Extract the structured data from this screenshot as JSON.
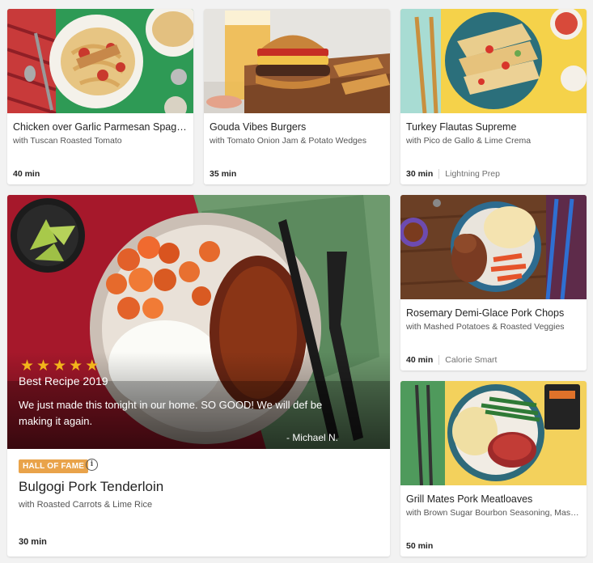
{
  "recipes": [
    {
      "title": "Chicken over Garlic Parmesan Spaghetti",
      "subtitle": "with Tuscan Roasted Tomato",
      "time": "40 min",
      "tag": ""
    },
    {
      "title": "Gouda Vibes Burgers",
      "subtitle": "with Tomato Onion Jam & Potato Wedges",
      "time": "35 min",
      "tag": ""
    },
    {
      "title": "Turkey Flautas Supreme",
      "subtitle": "with Pico de Gallo & Lime Crema",
      "time": "30 min",
      "tag": "Lightning Prep"
    },
    {
      "title": "Rosemary Demi-Glace Pork Chops",
      "subtitle": "with Mashed Potatoes & Roasted Veggies",
      "time": "40 min",
      "tag": "Calorie Smart"
    },
    {
      "title": "Grill Mates Pork Meatloaves",
      "subtitle": "with Brown Sugar Bourbon Seasoning, Mashed Potatoes",
      "time": "50 min",
      "tag": ""
    }
  ],
  "featured": {
    "rating_stars": 5,
    "award": "Best Recipe 2019",
    "review": "We just made this tonight in our home. SO GOOD! We will def be making it again.",
    "author": "- Michael N.",
    "badge": "HALL OF FAME",
    "title": "Bulgogi Pork Tenderloin",
    "subtitle": "with Roasted Carrots & Lime Rice",
    "time": "30 min"
  },
  "colors": {
    "star": "#f2b51b",
    "badge": "#e9a34a",
    "background": "#f2f2f2"
  },
  "icons": {
    "info": "info-icon",
    "star": "star-icon"
  }
}
